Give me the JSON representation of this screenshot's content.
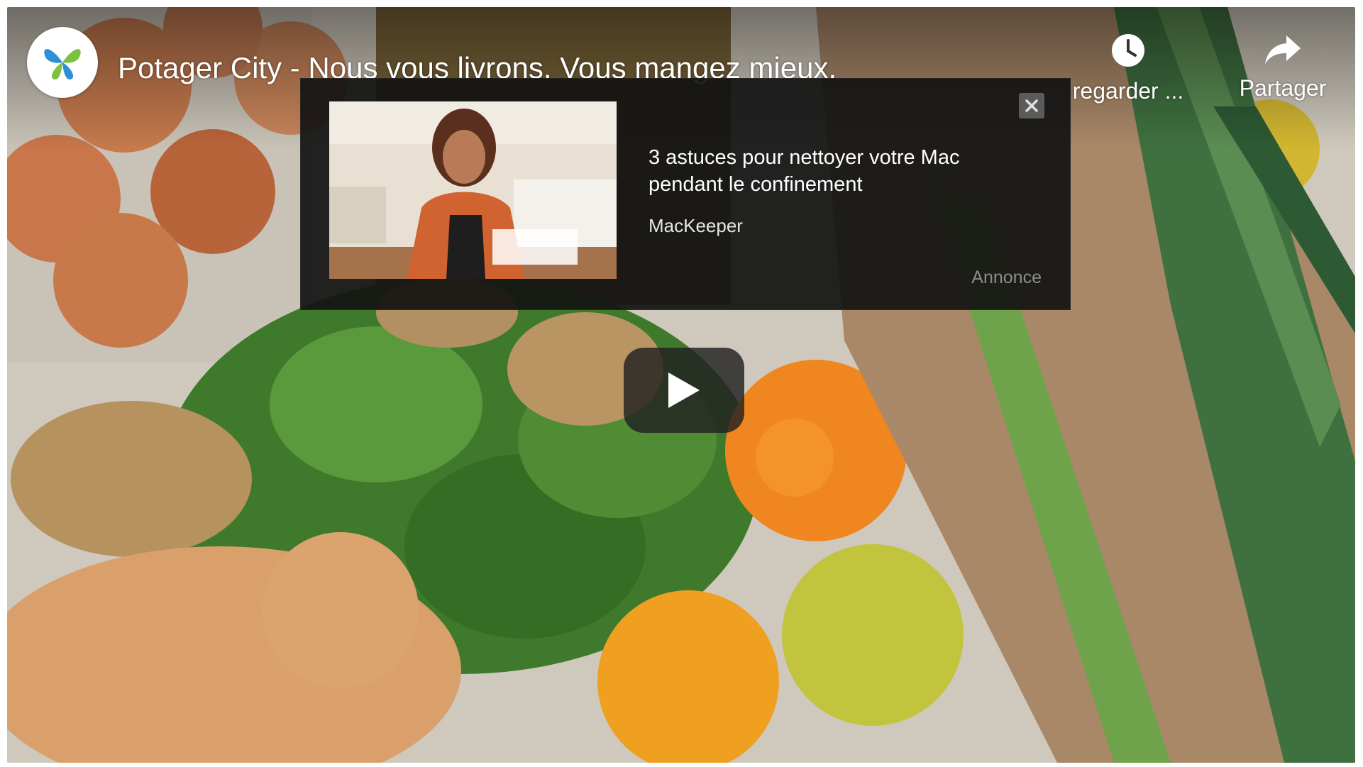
{
  "player": {
    "title": "Potager City - Nous vous livrons. Vous mangez mieux.",
    "channel_logo_icon": "butterfly-logo-icon",
    "actions": {
      "watch_later_label": "regarder ...",
      "watch_later_icon": "clock-icon",
      "share_label": "Partager",
      "share_icon": "share-arrow-icon"
    },
    "play_icon": "play-icon"
  },
  "ad": {
    "headline": "3 astuces pour nettoyer votre Mac pendant le confinement",
    "advertiser": "MacKeeper",
    "label": "Annonce",
    "close_icon": "close-icon"
  },
  "colors": {
    "logo_blue": "#2f8fd6",
    "logo_green": "#7cc242",
    "ad_background": "#121212",
    "play_button": "#212121"
  }
}
